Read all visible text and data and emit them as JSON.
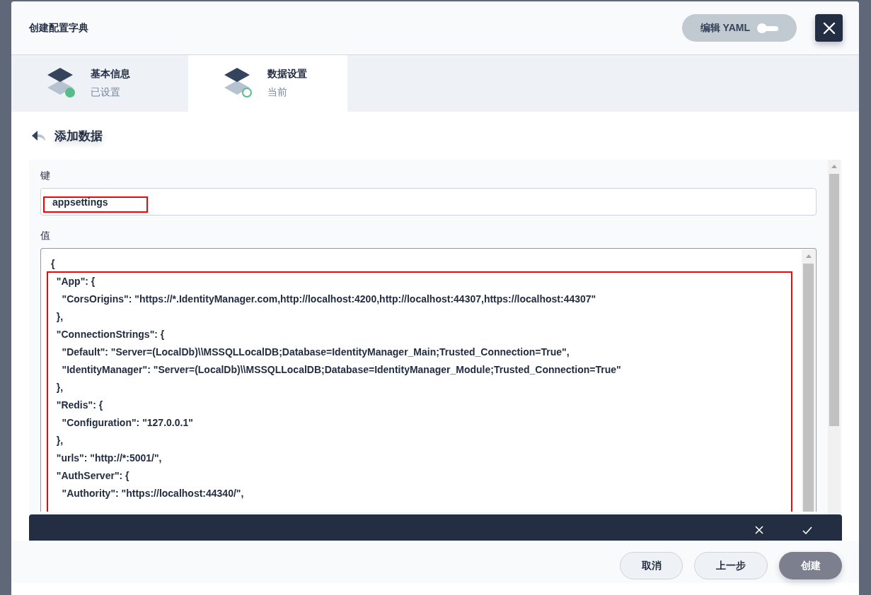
{
  "window": {
    "title": "创建配置字典"
  },
  "header_actions": {
    "yaml_toggle": {
      "label": "编辑 YAML",
      "on": false
    }
  },
  "steps": [
    {
      "title": "基本信息",
      "subtitle": "已设置",
      "done": true,
      "selected": false
    },
    {
      "title": "数据设置",
      "subtitle": "当前",
      "done": false,
      "selected": true
    }
  ],
  "section": {
    "title": "添加数据"
  },
  "key_field": {
    "label": "键",
    "value": "appsettings",
    "highlighted": true
  },
  "value_field": {
    "label": "值",
    "highlighted": true,
    "lines": [
      "{",
      "  \"App\": {",
      "    \"CorsOrigins\": \"https://*.IdentityManager.com,http://localhost:4200,http://localhost:44307,https://localhost:44307\"",
      "  },",
      "  \"ConnectionStrings\": {",
      "    \"Default\": \"Server=(LocalDb)\\\\MSSQLLocalDB;Database=IdentityManager_Main;Trusted_Connection=True\",",
      "    \"IdentityManager\": \"Server=(LocalDb)\\\\MSSQLLocalDB;Database=IdentityManager_Module;Trusted_Connection=True\"",
      "  },",
      "  \"Redis\": {",
      "    \"Configuration\": \"127.0.0.1\"",
      "  },",
      "  \"urls\": \"http://*:5001/\",",
      "  \"AuthServer\": {",
      "    \"Authority\": \"https://localhost:44340/\","
    ]
  },
  "buttons": [
    {
      "label": "取消",
      "kind": "secondary"
    },
    {
      "label": "上一步",
      "kind": "secondary"
    },
    {
      "label": "创建",
      "kind": "primary"
    }
  ]
}
